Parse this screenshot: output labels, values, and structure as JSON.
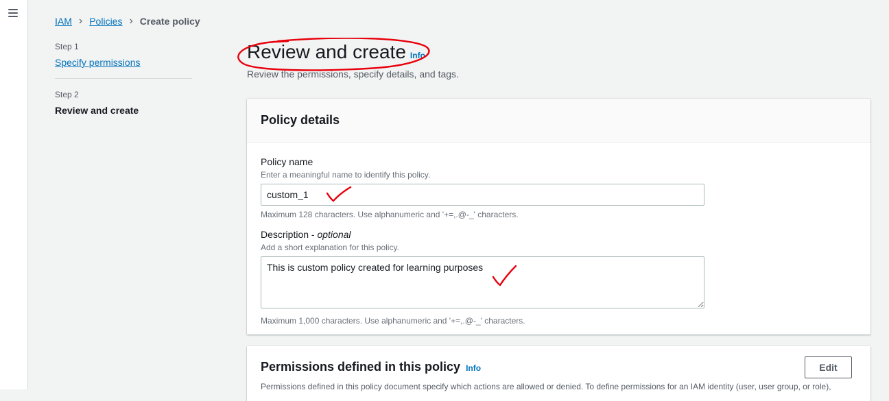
{
  "nav": {
    "menu_icon": "hamburger-menu-icon"
  },
  "breadcrumb": {
    "items": [
      {
        "label": "IAM"
      },
      {
        "label": "Policies"
      },
      {
        "label": "Create policy"
      }
    ]
  },
  "steps": [
    {
      "caption": "Step 1",
      "label": "Specify permissions"
    },
    {
      "caption": "Step 2",
      "label": "Review and create"
    }
  ],
  "header": {
    "title": "Review and create",
    "info": "Info",
    "description": "Review the permissions, specify details, and tags."
  },
  "policy_details": {
    "title": "Policy details",
    "name": {
      "label": "Policy name",
      "description": "Enter a meaningful name to identify this policy.",
      "value": "custom_1",
      "constraint": "Maximum 128 characters. Use alphanumeric and '+=,.@-_' characters."
    },
    "description": {
      "label": "Description - ",
      "label_optional": "optional",
      "description": "Add a short explanation for this policy.",
      "value": "This is custom policy created for learning purposes",
      "constraint": "Maximum 1,000 characters. Use alphanumeric and '+=,.@-_' characters."
    }
  },
  "permissions": {
    "title": "Permissions defined in this policy",
    "info": "Info",
    "edit_label": "Edit",
    "description": "Permissions defined in this policy document specify which actions are allowed or denied. To define permissions for an IAM identity (user, user group, or role),"
  },
  "colors": {
    "link": "#0073bb",
    "annotation": "#e8000b",
    "text": "#16191f",
    "muted": "#545b64"
  }
}
